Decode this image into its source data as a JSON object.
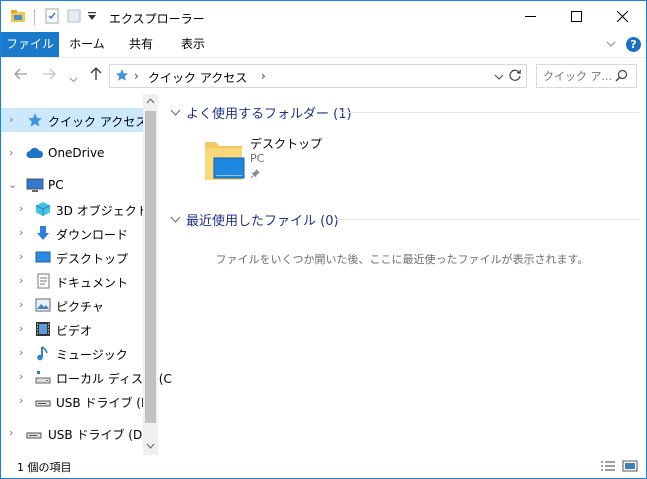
{
  "window": {
    "title": "エクスプローラー",
    "controls": {
      "minimize": "—",
      "maximize": "☐",
      "close": "✕"
    }
  },
  "ribbon": {
    "tabs": [
      {
        "label": "ファイル",
        "active": true
      },
      {
        "label": "ホーム",
        "active": false
      },
      {
        "label": "共有",
        "active": false
      },
      {
        "label": "表示",
        "active": false
      }
    ],
    "help_label": "?"
  },
  "address_bar": {
    "crumbs": [
      "クイック アクセス"
    ]
  },
  "search": {
    "placeholder": "クイック ア..."
  },
  "nav_tree": [
    {
      "label": "クイック アクセス",
      "icon": "star-icon",
      "selected": true
    },
    {
      "label": "OneDrive",
      "icon": "cloud-icon"
    },
    {
      "label": "PC",
      "icon": "computer-icon",
      "expanded": true
    },
    {
      "label": "3D オブジェクト",
      "icon": "3d-objects-icon"
    },
    {
      "label": "ダウンロード",
      "icon": "download-icon"
    },
    {
      "label": "デスクトップ",
      "icon": "desktop-icon"
    },
    {
      "label": "ドキュメント",
      "icon": "documents-icon"
    },
    {
      "label": "ピクチャ",
      "icon": "pictures-icon"
    },
    {
      "label": "ビデオ",
      "icon": "videos-icon"
    },
    {
      "label": "ミュージック",
      "icon": "music-icon"
    },
    {
      "label": "ローカル ディスク (C",
      "icon": "local-disk-icon"
    },
    {
      "label": "USB ドライブ (D:)",
      "icon": "usb-drive-icon"
    },
    {
      "label": "USB ドライブ (D:)",
      "icon": "usb-drive-icon"
    }
  ],
  "groups": {
    "frequent": {
      "header": "よく使用するフォルダー (1)",
      "items": [
        {
          "name": "デスクトップ",
          "location": "PC",
          "pinned": true,
          "icon": "desktop-folder-icon"
        }
      ]
    },
    "recent": {
      "header": "最近使用したファイル (0)",
      "empty_message": "ファイルをいくつか開いた後、ここに最近使ったファイルが表示されます。"
    }
  },
  "status_bar": {
    "item_count": "1 個の項目"
  },
  "colors": {
    "accent": "#1979ca",
    "selection": "#cce8ff",
    "group_header": "#1e3287"
  }
}
